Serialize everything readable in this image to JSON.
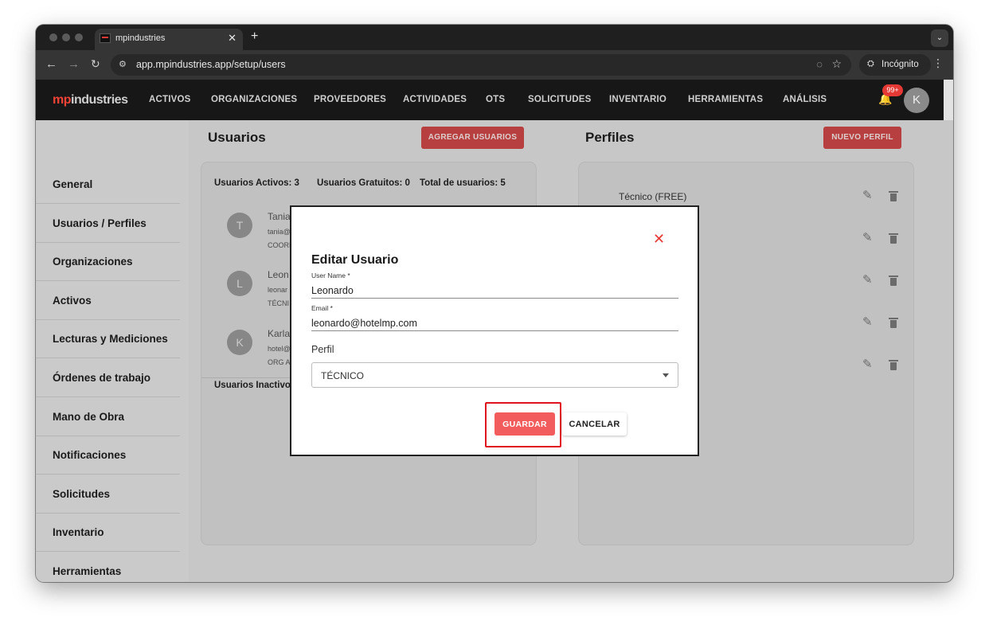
{
  "browser": {
    "tab_title": "mpindustries",
    "url": "app.mpindustries.app/setup/users",
    "incognito_label": "Incógnito"
  },
  "app": {
    "logo_mp": "mp",
    "logo_rest": "industries",
    "nav": [
      "ACTIVOS",
      "ORGANIZACIONES",
      "PROVEEDORES",
      "ACTIVIDADES",
      "OTS",
      "SOLICITUDES",
      "INVENTARIO",
      "HERRAMIENTAS",
      "ANÁLISIS"
    ],
    "notifications_badge": "99+",
    "avatar_initial": "K",
    "accent_color": "#f44336"
  },
  "sidebar": {
    "items": [
      "General",
      "Usuarios / Perfiles",
      "Organizaciones",
      "Activos",
      "Lecturas y Mediciones",
      "Órdenes de trabajo",
      "Mano de Obra",
      "Notificaciones",
      "Solicitudes",
      "Inventario",
      "Herramientas"
    ]
  },
  "users": {
    "title": "Usuarios",
    "add_button": "AGREGAR USUARIOS",
    "stats": {
      "active": "Usuarios Activos: 3",
      "free": "Usuarios Gratuitos: 0",
      "total": "Total de usuarios: 5"
    },
    "list": [
      {
        "initial": "T",
        "name": "Tania",
        "email": "tania@",
        "role": "COORD"
      },
      {
        "initial": "L",
        "name": "Leon",
        "email": "leonar",
        "role": "TÉCNI"
      },
      {
        "initial": "K",
        "name": "Karla",
        "email": "hotel@",
        "role": "ORG A"
      }
    ],
    "inactive_label": "Usuarios Inactivos"
  },
  "profiles": {
    "title": "Perfiles",
    "new_button": "NUEVO PERFIL",
    "first_profile": "Técnico (FREE)"
  },
  "modal": {
    "title": "Editar Usuario",
    "username_label": "User Name *",
    "username_value": "Leonardo",
    "email_label": "Email *",
    "email_value": "leonardo@hotelmp.com",
    "perfil_label": "Perfil",
    "perfil_value": "TÉCNICO",
    "save_label": "GUARDAR",
    "cancel_label": "CANCELAR"
  }
}
